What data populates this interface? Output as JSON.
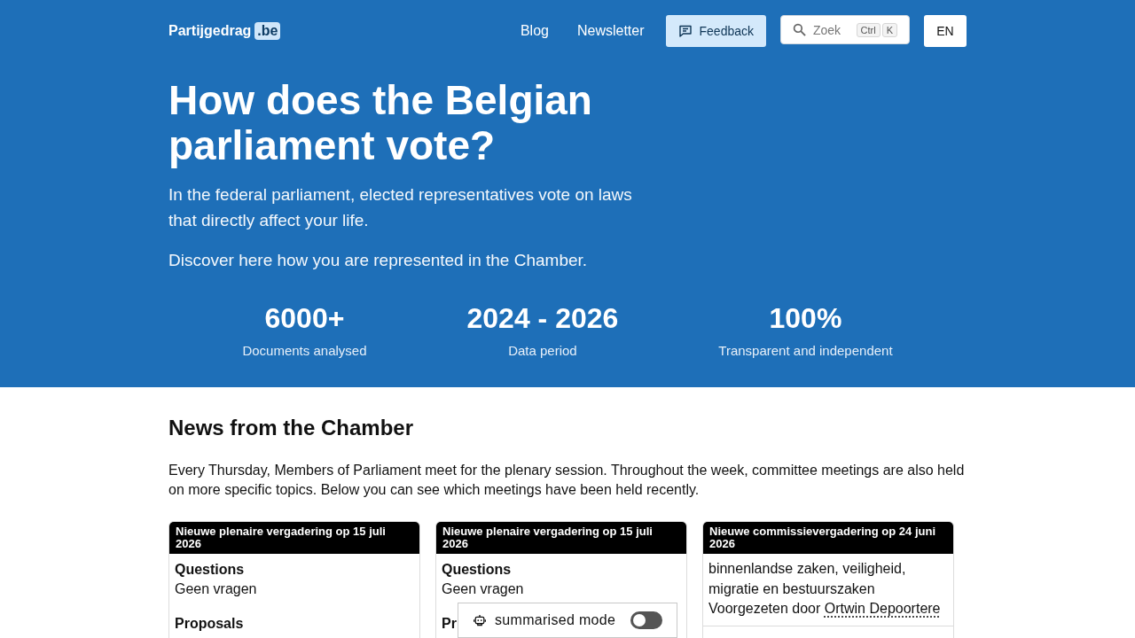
{
  "header": {
    "logo": {
      "name": "Partijgedrag",
      "suffix": ".be"
    },
    "nav": [
      {
        "label": "Blog"
      },
      {
        "label": "Newsletter"
      }
    ],
    "feedback_button": {
      "label": "Feedback"
    },
    "search": {
      "placeholder": "Zoek",
      "shortcut": [
        "Ctrl",
        "K"
      ]
    },
    "language_button": {
      "label": "EN"
    }
  },
  "hero": {
    "title": "How does the Belgian parliament vote?",
    "paragraphs": [
      "In the federal parliament, elected representatives vote on laws that directly affect your life.",
      "Discover here how you are represented in the Chamber."
    ],
    "stats": [
      {
        "value": "6000+",
        "label": "Documents analysed"
      },
      {
        "value": "2024 - 2026",
        "label": "Data period"
      },
      {
        "value": "100%",
        "label": "Transparent and independent"
      }
    ]
  },
  "news": {
    "title": "News from the Chamber",
    "intro": "Every Thursday, Members of Parliament meet for the plenary session. Throughout the week, committee meetings are also held on more specific topics. Below you can see which meetings have been held recently.",
    "cards": [
      {
        "kind": "plenary",
        "heading": "Nieuwe plenaire vergadering op 15 juli 2026",
        "sections": [
          {
            "title": "Questions",
            "text": "Geen vragen"
          },
          {
            "title": "Proposals"
          }
        ]
      },
      {
        "kind": "plenary",
        "heading": "Nieuwe plenaire vergadering op 15 juli 2026",
        "sections": [
          {
            "title": "Questions",
            "text": "Geen vragen"
          },
          {
            "title": "Pr"
          }
        ]
      },
      {
        "kind": "committee",
        "heading": "Nieuwe commissievergadering op 24 juni 2026",
        "committee": "binnenlandse zaken, veiligheid, migratie en bestuurszaken",
        "chair_label": "Voorgezeten door",
        "chair": "Ortwin Depoortere"
      }
    ]
  },
  "summary_toggle": {
    "label": "summarised mode",
    "on": false
  }
}
